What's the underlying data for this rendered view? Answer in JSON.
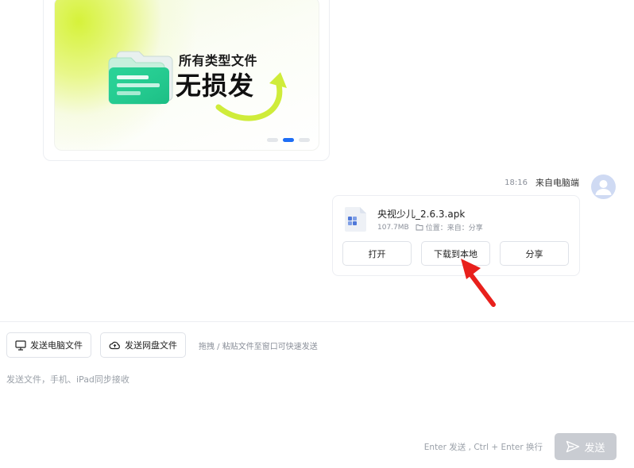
{
  "banner": {
    "line1": "所有类型文件",
    "line2": "无损发",
    "carousel_count": 3,
    "carousel_active": 2
  },
  "message": {
    "time": "18:16",
    "source": "来自电脑端",
    "file": {
      "name": "央视少儿_2.6.3.apk",
      "size": "107.7MB",
      "location": "位置：来自：分享",
      "icon": "apk-file-icon"
    },
    "actions": {
      "open": "打开",
      "download": "下载到本地",
      "share": "分享"
    }
  },
  "composer": {
    "send_pc_file": "发送电脑文件",
    "send_cloud_file": "发送网盘文件",
    "drag_hint": "拖拽 / 粘贴文件至窗口可快速发送",
    "placeholder": "发送文件，手机、iPad同步接收",
    "shortcut_hint": "Enter 发送 , Ctrl + Enter 换行",
    "send_label": "发送"
  },
  "colors": {
    "accent": "#1e6ef5",
    "annotation_arrow": "#e8201c",
    "send_disabled": "#c9ccd2"
  }
}
